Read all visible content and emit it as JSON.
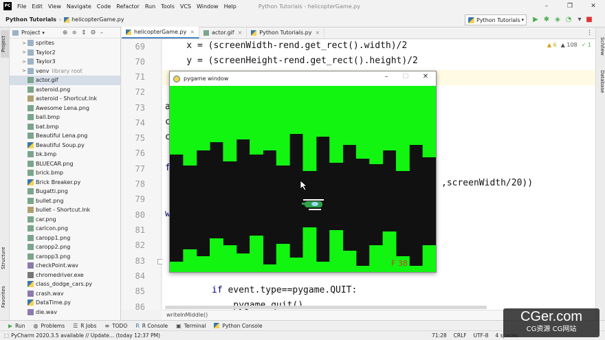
{
  "app": {
    "menu": [
      "File",
      "Edit",
      "View",
      "Navigate",
      "Code",
      "Refactor",
      "Run",
      "Tools",
      "VCS",
      "Window",
      "Help"
    ],
    "window_title": "Python Tutorials - helicopterGame.py",
    "logo": "PC"
  },
  "nav": {
    "project": "Python Tutorials",
    "file": "helicopterGame.py",
    "run_config": "Python Tutorials"
  },
  "project_panel": {
    "title": "Project",
    "items": [
      {
        "label": "sprites",
        "type": "folder",
        "arrow": ">"
      },
      {
        "label": "Taylor2",
        "type": "folder",
        "arrow": ">"
      },
      {
        "label": "Taylor3",
        "type": "folder",
        "arrow": ">"
      },
      {
        "label": "venv",
        "type": "folder",
        "arrow": ">",
        "suffix": "library root"
      },
      {
        "label": "actor.gif",
        "type": "img",
        "selected": true
      },
      {
        "label": "asteroid.png",
        "type": "img"
      },
      {
        "label": "asteroid - Shortcut.lnk",
        "type": "lnk"
      },
      {
        "label": "Awesome Lena.png",
        "type": "img"
      },
      {
        "label": "ball.bmp",
        "type": "img"
      },
      {
        "label": "bat.bmp",
        "type": "img"
      },
      {
        "label": "Beautiful Lena.png",
        "type": "img"
      },
      {
        "label": "Beautiful Soup.py",
        "type": "py"
      },
      {
        "label": "bk.bmp",
        "type": "img"
      },
      {
        "label": "BLUECAR.png",
        "type": "img"
      },
      {
        "label": "brick.bmp",
        "type": "img"
      },
      {
        "label": "Brick Breaker.py",
        "type": "py"
      },
      {
        "label": "Bugatti.png",
        "type": "img"
      },
      {
        "label": "bullet.png",
        "type": "img"
      },
      {
        "label": "bullet - Shortcut.lnk",
        "type": "lnk"
      },
      {
        "label": "car.png",
        "type": "img"
      },
      {
        "label": "carlcon.png",
        "type": "img"
      },
      {
        "label": "caropp1.png",
        "type": "img"
      },
      {
        "label": "caropp2.png",
        "type": "img"
      },
      {
        "label": "caropp3.png",
        "type": "img"
      },
      {
        "label": "checkPoint.wav",
        "type": "wav"
      },
      {
        "label": "chromedriver.exe",
        "type": "exe"
      },
      {
        "label": "class_dodge_cars.py",
        "type": "py"
      },
      {
        "label": "crash.wav",
        "type": "wav"
      },
      {
        "label": "DataTime.py",
        "type": "py"
      },
      {
        "label": "die.wav",
        "type": "wav"
      }
    ]
  },
  "tabs": [
    {
      "label": "helicopterGame.py",
      "active": true,
      "icon": "py"
    },
    {
      "label": "actor.gif",
      "active": false,
      "icon": "img"
    },
    {
      "label": "Python Tutorials.py",
      "active": false,
      "icon": "py"
    }
  ],
  "editor": {
    "line_numbers": [
      "69",
      "70",
      "71",
      "72",
      "73",
      "74",
      "75",
      "76",
      "77",
      "78",
      "79",
      "80",
      "81",
      "82",
      "83",
      "84",
      "85",
      "86"
    ],
    "lines": {
      "l69": "    x = (screenWidth-rend.get_rect().width)/2",
      "l70": "    y = (screenHeight-rend.get_rect().height)/2",
      "l73": "a",
      "l74": "c",
      "l75": "c",
      "l77": "f",
      "l78": ",screenWidth/20))",
      "l80": "w",
      "l85_kw": "if",
      "l85_rest": " event.type==pygame.QUIT:",
      "l86": "    pygame.quit()"
    },
    "inspections": {
      "warnings": "6",
      "weak": "108",
      "typos": "1"
    },
    "breadcrumb": "writeInMiddle()"
  },
  "pygame_window": {
    "title": "pygame window",
    "score": "F 38"
  },
  "tool_windows": [
    {
      "label": "Run",
      "icon": "run-icon"
    },
    {
      "label": "Problems",
      "icon": "problems-icon"
    },
    {
      "label": "R Jobs",
      "icon": "rjobs-icon"
    },
    {
      "label": "TODO",
      "icon": "todo-icon"
    },
    {
      "label": "R Console",
      "icon": "rconsole-icon"
    },
    {
      "label": "Terminal",
      "icon": "terminal-icon"
    },
    {
      "label": "Python Console",
      "icon": "python-console-icon"
    }
  ],
  "status": {
    "message": "PyCharm 2020.3.5 available // Update... (today 12:37 PM)",
    "position": "71:28",
    "line_sep": "CRLF",
    "encoding": "UTF-8",
    "indent": "4 spaces"
  },
  "side_tabs": {
    "left": [
      "Project",
      "Structure",
      "Favorites"
    ],
    "right": [
      "SciView",
      "Database"
    ]
  },
  "watermark": {
    "big": "CGer.com",
    "small": "CG资源 CG网站"
  },
  "colors": {
    "game_green": "#11f511",
    "game_dark": "#111111",
    "score_red": "#d33"
  }
}
